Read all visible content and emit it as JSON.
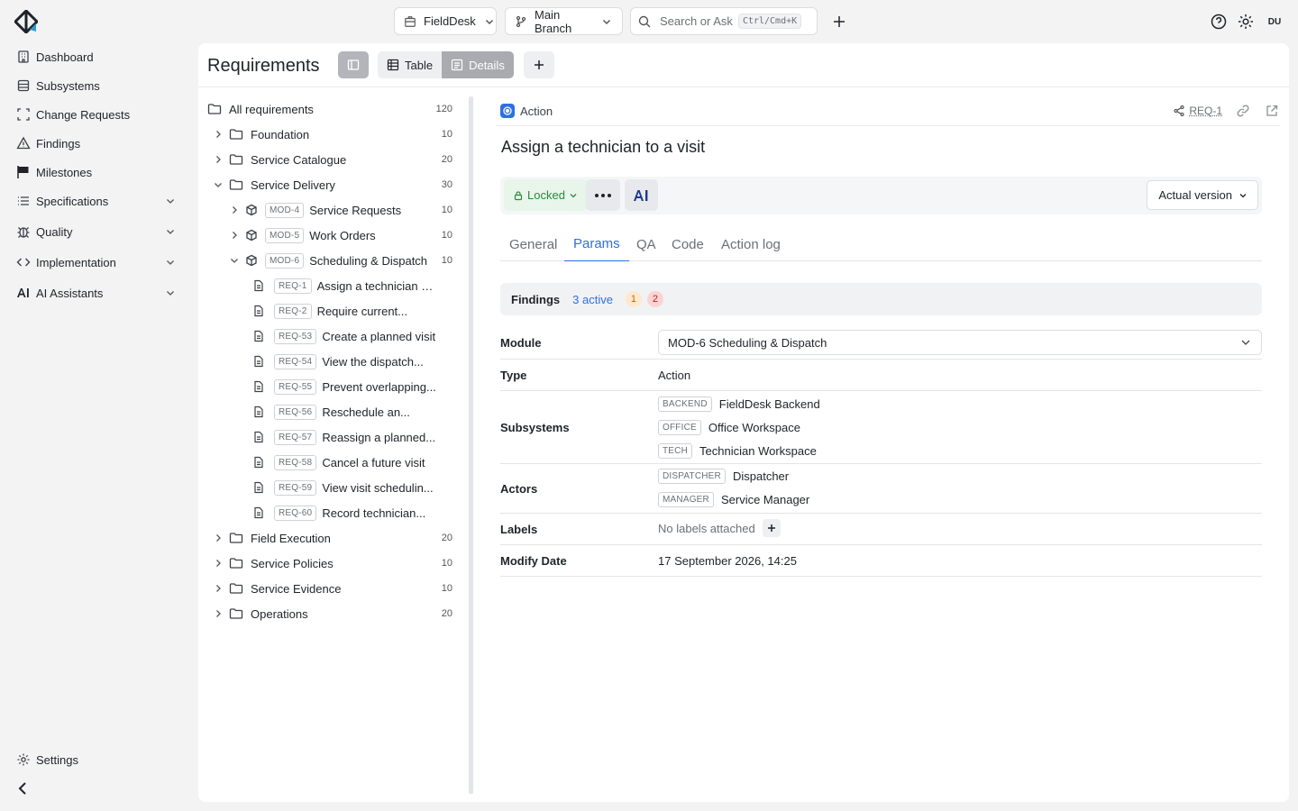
{
  "sidebar": {
    "items": [
      {
        "label": "Dashboard",
        "icon": "building-icon"
      },
      {
        "label": "Subsystems",
        "icon": "database-icon"
      },
      {
        "label": "Change Requests",
        "icon": "brackets-icon"
      },
      {
        "label": "Findings",
        "icon": "warning-icon"
      },
      {
        "label": "Milestones",
        "icon": "flag-icon"
      },
      {
        "label": "Specifications",
        "icon": "list-icon"
      },
      {
        "label": "Quality",
        "icon": "bug-icon"
      },
      {
        "label": "Implementation",
        "icon": "code-icon"
      },
      {
        "label": "AI Assistants",
        "icon": "ai-icon"
      }
    ],
    "settings_label": "Settings"
  },
  "topbar": {
    "project": "FieldDesk",
    "branch": "Main Branch",
    "search_placeholder": "Search or Ask",
    "search_shortcut": "Ctrl/Cmd+K",
    "avatar": "DU"
  },
  "main": {
    "title": "Requirements",
    "view_table": "Table",
    "view_details": "Details"
  },
  "tree": {
    "root": {
      "label": "All requirements",
      "count": "120"
    },
    "groups_top": [
      {
        "label": "Foundation",
        "count": "10"
      },
      {
        "label": "Service Catalogue",
        "count": "20"
      },
      {
        "label": "Service Delivery",
        "count": "30"
      }
    ],
    "modules": [
      {
        "tag": "MOD-4",
        "label": "Service Requests",
        "count": "10"
      },
      {
        "tag": "MOD-5",
        "label": "Work Orders",
        "count": "10"
      },
      {
        "tag": "MOD-6",
        "label": "Scheduling & Dispatch",
        "count": "10"
      }
    ],
    "requirements": [
      {
        "tag": "REQ-1",
        "label": "Assign a technician t..."
      },
      {
        "tag": "REQ-2",
        "label": "Require current..."
      },
      {
        "tag": "REQ-53",
        "label": "Create a planned visit"
      },
      {
        "tag": "REQ-54",
        "label": "View the dispatch..."
      },
      {
        "tag": "REQ-55",
        "label": "Prevent overlapping..."
      },
      {
        "tag": "REQ-56",
        "label": "Reschedule an..."
      },
      {
        "tag": "REQ-57",
        "label": "Reassign a planned..."
      },
      {
        "tag": "REQ-58",
        "label": "Cancel a future visit"
      },
      {
        "tag": "REQ-59",
        "label": "View visit schedulin..."
      },
      {
        "tag": "REQ-60",
        "label": "Record technician..."
      }
    ],
    "groups_bottom": [
      {
        "label": "Field Execution",
        "count": "20"
      },
      {
        "label": "Service Policies",
        "count": "10"
      },
      {
        "label": "Service Evidence",
        "count": "10"
      },
      {
        "label": "Operations",
        "count": "20"
      }
    ]
  },
  "detail": {
    "type": "Action",
    "ref": "REQ-1",
    "title": "Assign a technician to a visit",
    "status": "Locked",
    "ai_label": "AI",
    "version": "Actual version",
    "tabs": [
      "General",
      "Params",
      "QA",
      "Code",
      "Action log"
    ],
    "active_tab": "Params",
    "findings": {
      "label": "Findings",
      "active": "3 active",
      "orange": "1",
      "red": "2"
    },
    "params": {
      "module_label": "Module",
      "module_value": "MOD-6 Scheduling & Dispatch",
      "type_label": "Type",
      "type_value": "Action",
      "subsystems_label": "Subsystems",
      "subsystems": [
        {
          "tag": "BACKEND",
          "name": "FieldDesk Backend"
        },
        {
          "tag": "OFFICE",
          "name": "Office Workspace"
        },
        {
          "tag": "TECH",
          "name": "Technician Workspace"
        }
      ],
      "actors_label": "Actors",
      "actors": [
        {
          "tag": "DISPATCHER",
          "name": "Dispatcher"
        },
        {
          "tag": "MANAGER",
          "name": "Service Manager"
        }
      ],
      "labels_label": "Labels",
      "labels_empty": "No labels attached",
      "modify_label": "Modify Date",
      "modify_value": "17 September 2026, 14:25"
    }
  },
  "colors": {
    "accent": "#2f6fe4",
    "locked": "#2b8a3e",
    "warning": "#c26a00",
    "danger": "#b3261e"
  }
}
